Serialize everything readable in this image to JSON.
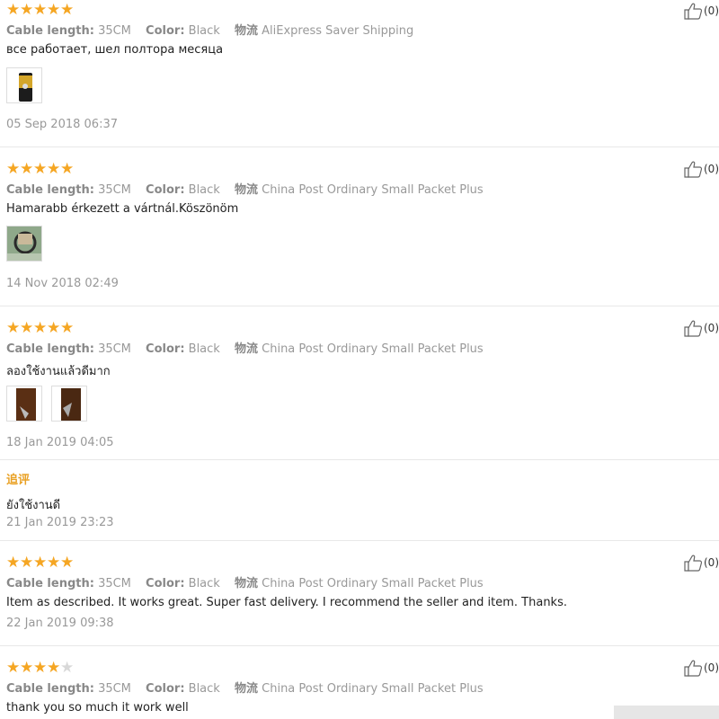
{
  "labels": {
    "cable_length": "Cable length:",
    "color": "Color:",
    "shipping": "物流"
  },
  "reviews": [
    {
      "rating": 5,
      "likes": "(0)",
      "cable_length": "35CM",
      "color": "Black",
      "shipping": "AliExpress Saver Shipping",
      "text": "все работает, шел полтора месяца",
      "date": "05 Sep 2018 06:37"
    },
    {
      "rating": 5,
      "likes": "(0)",
      "cable_length": "35CM",
      "color": "Black",
      "shipping": "China Post Ordinary Small Packet Plus",
      "text": "Hamarabb érkezett a vártnál.Köszönöm",
      "date": "14 Nov 2018 02:49"
    },
    {
      "rating": 5,
      "likes": "(0)",
      "cable_length": "35CM",
      "color": "Black",
      "shipping": "China Post Ordinary Small Packet Plus",
      "text": "ลองใช้งานแล้วดีมาก",
      "date": "18 Jan 2019 04:05",
      "followup_label": "追评",
      "followup_text": "ยังใช้งานดี",
      "followup_date": "21 Jan 2019 23:23"
    },
    {
      "rating": 5,
      "likes": "(0)",
      "cable_length": "35CM",
      "color": "Black",
      "shipping": "China Post Ordinary Small Packet Plus",
      "text": "Item as described. It works great. Super fast delivery. I recommend the seller and item. Thanks.",
      "date": "22 Jan 2019 09:38"
    },
    {
      "rating": 4,
      "likes": "(0)",
      "cable_length": "35CM",
      "color": "Black",
      "shipping": "China Post Ordinary Small Packet Plus",
      "text": "thank you so much it work well"
    }
  ]
}
